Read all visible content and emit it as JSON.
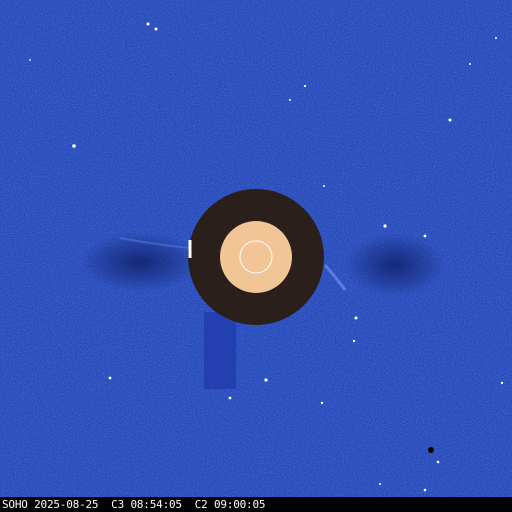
{
  "image": {
    "kind": "coronagraph-difference-image",
    "background_color": "#2447b8",
    "occulter_ring_color": "#2a1f1a",
    "inner_disk_color": "#f2c596",
    "sun_outline_color": "#ffffff"
  },
  "caption": {
    "text": "SOHO 2025-08-25  C3 08:54:05  C2 09:00:05"
  }
}
